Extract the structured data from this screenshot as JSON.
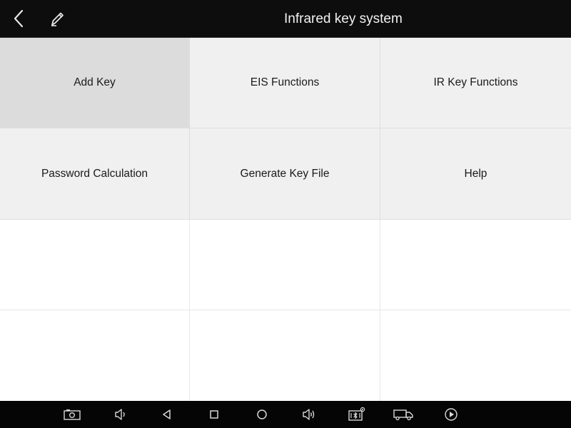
{
  "header": {
    "title": "Infrared key system",
    "back_icon": "chevron-left-icon",
    "edit_icon": "pencil-icon"
  },
  "menu": {
    "items": [
      {
        "label": "Add Key",
        "selected": true
      },
      {
        "label": "EIS Functions",
        "selected": false
      },
      {
        "label": "IR Key Functions",
        "selected": false
      },
      {
        "label": "Password Calculation",
        "selected": false
      },
      {
        "label": "Generate Key File",
        "selected": false
      },
      {
        "label": "Help",
        "selected": false
      }
    ]
  },
  "navbar": {
    "icons": [
      "screenshot-icon",
      "volume-down-icon",
      "back-triangle-icon",
      "recent-apps-square-icon",
      "home-circle-icon",
      "volume-up-icon",
      "vci-bluetooth-icon",
      "truck-icon",
      "play-icon"
    ]
  },
  "colors": {
    "header_bg": "#0d0d0d",
    "tile_bg": "#f0f0f0",
    "tile_selected_bg": "#dcdcdc",
    "navbar_bg": "#050505"
  }
}
